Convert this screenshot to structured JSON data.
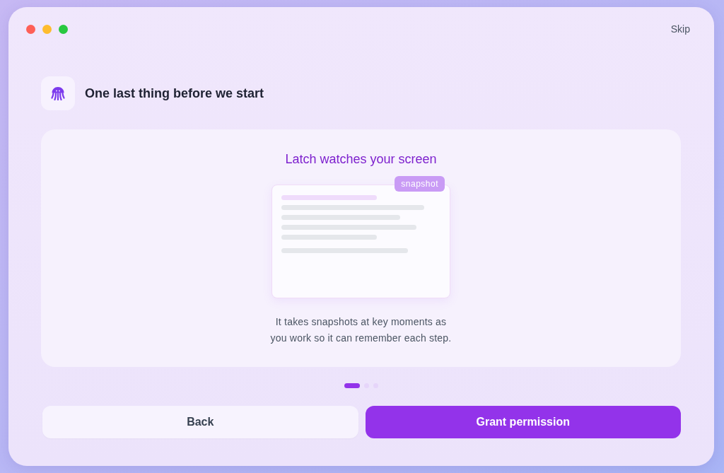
{
  "window": {
    "skip_link": "Skip"
  },
  "header": {
    "title": "One last thing before we start"
  },
  "card": {
    "title": "Latch watches your screen",
    "badge": "snapshot",
    "description": "It takes snapshots at key moments as you work so it can remember each step."
  },
  "pager": [
    {
      "selected": true
    },
    {
      "selected": false
    },
    {
      "selected": false
    }
  ],
  "buttons": [
    {
      "label": "Back",
      "kind": "secondary"
    },
    {
      "label": "Grant permission",
      "kind": "primary"
    }
  ]
}
